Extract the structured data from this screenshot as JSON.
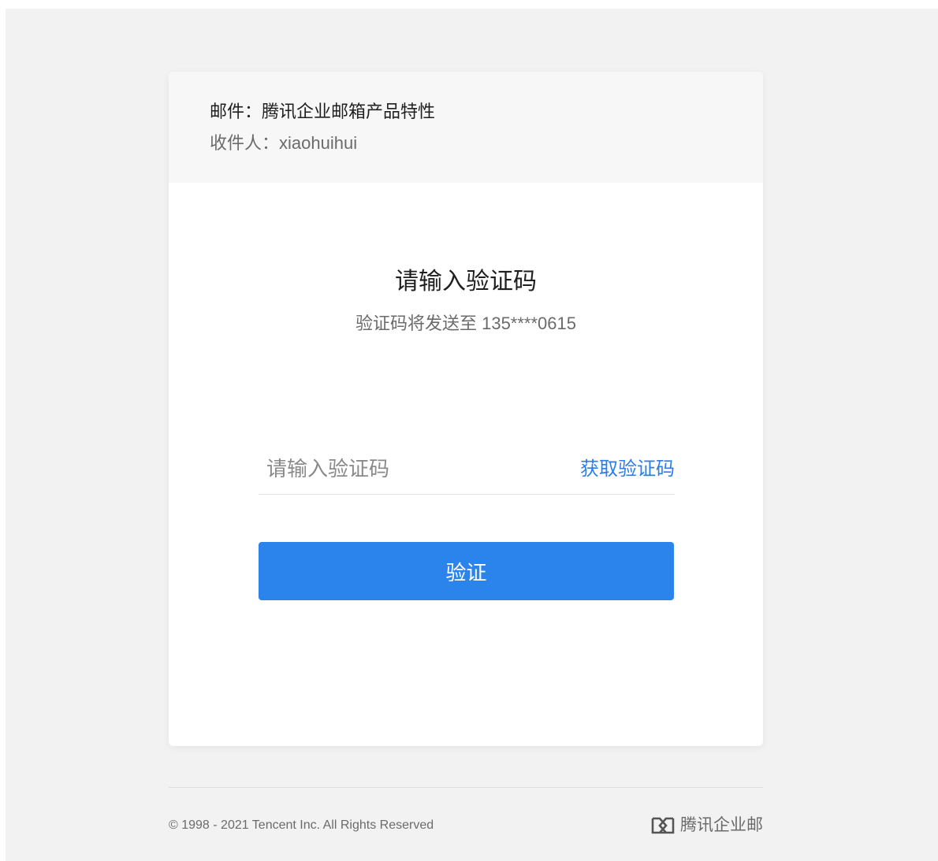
{
  "mail": {
    "subject": "邮件：腾讯企业邮箱产品特性",
    "recipient": "收件人：xiaohuihui"
  },
  "verification": {
    "title": "请输入验证码",
    "subtitle": "验证码将发送至 135****0615",
    "input_placeholder": "请输入验证码",
    "input_value": "",
    "get_code_label": "获取验证码",
    "submit_label": "验证"
  },
  "footer": {
    "copyright": "© 1998 - 2021 Tencent Inc. All Rights Reserved",
    "brand_name": "腾讯企业邮",
    "brand_icon": "tencent-exmail-logo-icon"
  },
  "colors": {
    "accent": "#2b84ec",
    "link": "#2b7de9",
    "page_background": "#f2f2f2",
    "card_background": "#ffffff",
    "header_background": "#f7f7f7"
  }
}
